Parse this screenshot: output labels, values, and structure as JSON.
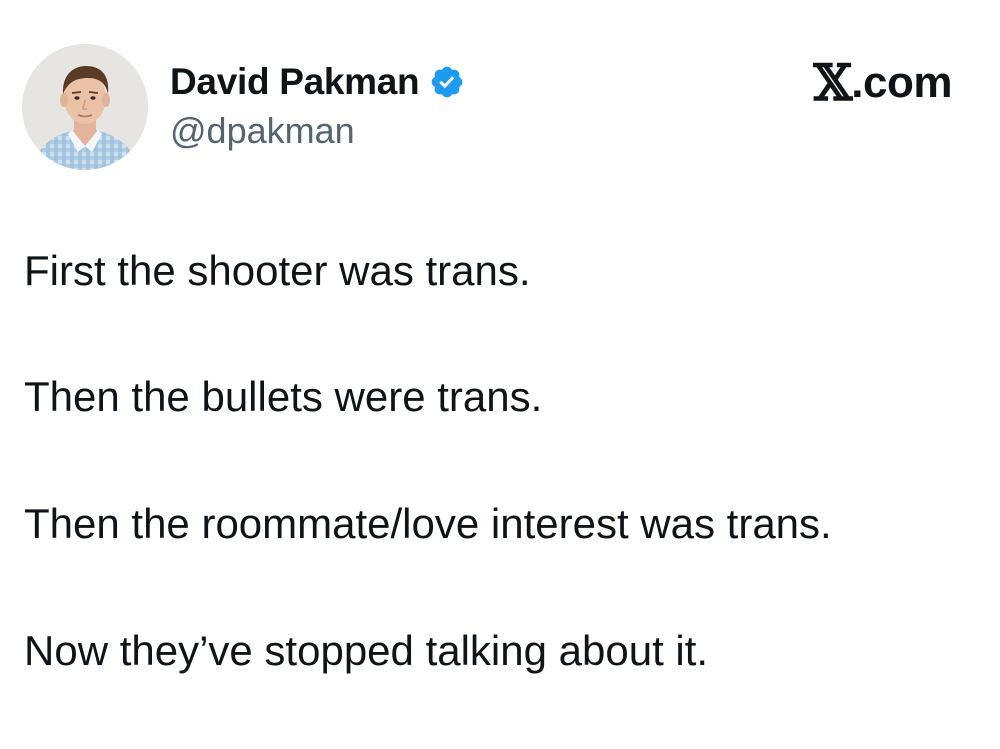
{
  "author": {
    "display_name": "David Pakman",
    "handle": "@dpakman",
    "verified": true,
    "avatar_icon": "profile-photo",
    "verified_icon": "verified-badge-icon",
    "verified_color": "#1d9bf0"
  },
  "brand": {
    "logo": "𝕏",
    "domain": ".com"
  },
  "tweet": {
    "lines": [
      "First the shooter was trans.",
      "Then the bullets were trans.",
      "Then the roommate/love interest was trans.",
      "Now they’ve stopped talking about it."
    ]
  },
  "colors": {
    "text": "#0f1419",
    "secondary_text": "#536471",
    "background": "#ffffff"
  }
}
